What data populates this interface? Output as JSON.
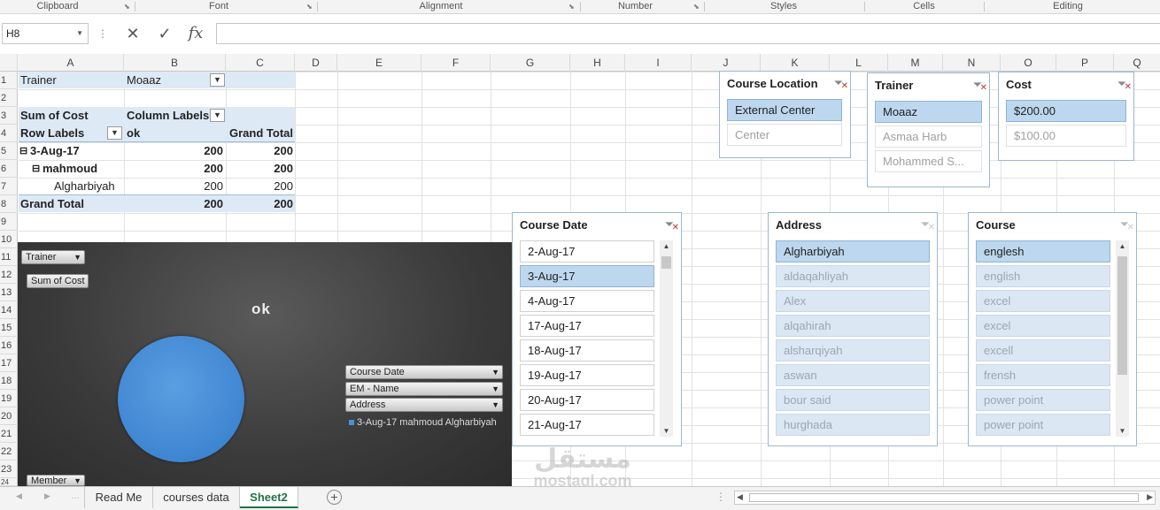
{
  "ribbon": {
    "groups": [
      "Clipboard",
      "Font",
      "Alignment",
      "Number",
      "Styles",
      "Cells",
      "Editing"
    ]
  },
  "formula_bar": {
    "name_box": "H8",
    "formula": ""
  },
  "columns": [
    "A",
    "B",
    "C",
    "D",
    "E",
    "F",
    "G",
    "H",
    "I",
    "J",
    "K",
    "L",
    "M",
    "N",
    "O",
    "P",
    "Q"
  ],
  "rows": [
    "1",
    "2",
    "3",
    "4",
    "5",
    "6",
    "7",
    "8",
    "9",
    "10",
    "11",
    "12",
    "13",
    "14",
    "15",
    "16",
    "17",
    "18",
    "19",
    "20",
    "21",
    "22",
    "23",
    "24"
  ],
  "pivot": {
    "filter_label": "Trainer",
    "filter_value": "Moaaz",
    "values_label": "Sum of Cost",
    "col_labels": "Column Labels",
    "row_labels": "Row Labels",
    "col_item": "ok",
    "grand_total_col": "Grand Total",
    "rows": [
      {
        "label": "3-Aug-17",
        "ok": "200",
        "total": "200"
      },
      {
        "label": "mahmoud",
        "ok": "200",
        "total": "200"
      },
      {
        "label": "Algharbiyah",
        "ok": "200",
        "total": "200"
      }
    ],
    "grand_total": {
      "label": "Grand Total",
      "ok": "200",
      "total": "200"
    },
    "expand_glyph": "⊟"
  },
  "chart": {
    "title": "ok",
    "trainer_button": "Trainer",
    "value_button": "Sum of Cost",
    "axis_buttons": [
      "Course Date",
      "EM - Name",
      "Address"
    ],
    "legend_entry": "3-Aug-17 mahmoud Algharbiyah",
    "member_button": "Member",
    "series_color": "#4a90d9",
    "chart_data": {
      "type": "pie",
      "title": "ok",
      "categories": [
        "3-Aug-17 mahmoud Algharbiyah"
      ],
      "values": [
        200
      ]
    }
  },
  "slicers": {
    "course_location": {
      "title": "Course Location",
      "items": [
        "External Center",
        "Center"
      ]
    },
    "trainer": {
      "title": "Trainer",
      "items": [
        "Moaaz",
        "Asmaa Harb",
        "Mohammed S..."
      ]
    },
    "cost": {
      "title": "Cost",
      "items": [
        "$200.00",
        "$100.00"
      ]
    },
    "course_date": {
      "title": "Course Date",
      "items": [
        "2-Aug-17",
        "3-Aug-17",
        "4-Aug-17",
        "17-Aug-17",
        "18-Aug-17",
        "19-Aug-17",
        "20-Aug-17",
        "21-Aug-17"
      ]
    },
    "address": {
      "title": "Address",
      "items": [
        "Algharbiyah",
        "aldaqahliyah",
        "Alex",
        "alqahirah",
        "alsharqiyah",
        "aswan",
        "bour said",
        "hurghada"
      ]
    },
    "course": {
      "title": "Course",
      "items": [
        "englesh",
        "english",
        "excel",
        "excel",
        "excell",
        "frensh",
        "power point",
        "power point"
      ]
    }
  },
  "tabs": [
    "Read Me",
    "courses data",
    "Sheet2"
  ],
  "active_tab": "Sheet2",
  "watermark": {
    "line1": "مستقل",
    "line2": "mostaql.com"
  }
}
